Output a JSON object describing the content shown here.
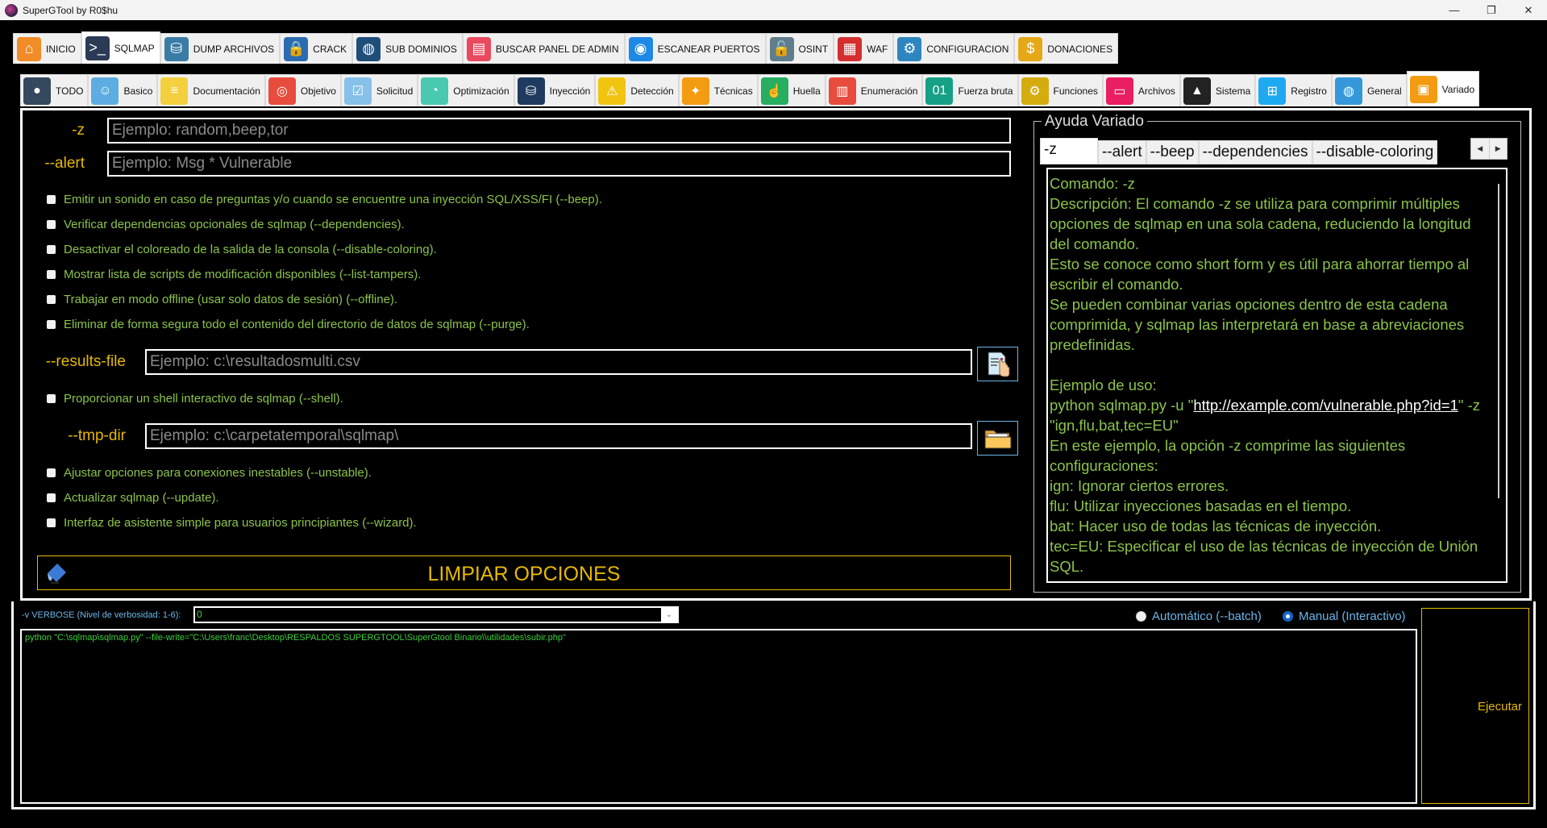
{
  "window": {
    "title": "SuperGTool by R0$hu",
    "controls": [
      "minimize",
      "maximize",
      "close"
    ]
  },
  "main_tabs": [
    {
      "label": "INICIO",
      "icon": "home-icon",
      "color": "#f28c28"
    },
    {
      "label": "SQLMAP",
      "icon": "terminal-icon",
      "color": "#2b3a55",
      "active": true
    },
    {
      "label": "DUMP ARCHIVOS",
      "icon": "database-download-icon",
      "color": "#3a7ca5"
    },
    {
      "label": "CRACK",
      "icon": "password-lock-icon",
      "color": "#2b6cb0"
    },
    {
      "label": "SUB DOMINIOS",
      "icon": "network-globe-icon",
      "color": "#1f4e79"
    },
    {
      "label": "BUSCAR PANEL DE ADMIN",
      "icon": "admin-panel-icon",
      "color": "#e84a5f"
    },
    {
      "label": "ESCANEAR PUERTOS",
      "icon": "port-scan-icon",
      "color": "#1e88e5"
    },
    {
      "label": "OSINT",
      "icon": "unlock-user-icon",
      "color": "#607d8b"
    },
    {
      "label": "WAF",
      "icon": "firewall-icon",
      "color": "#d32f2f"
    },
    {
      "label": "CONFIGURACION",
      "icon": "gear-icon",
      "color": "#2e86c1"
    },
    {
      "label": "DONACIONES",
      "icon": "donate-box-icon",
      "color": "#e6a817"
    }
  ],
  "sub_tabs": [
    {
      "label": "TODO",
      "icon": "hacker-icon",
      "color": "#34495e"
    },
    {
      "label": "Basico",
      "icon": "robot-icon",
      "color": "#5dade2"
    },
    {
      "label": "Documentación",
      "icon": "sql-document-icon",
      "color": "#f4d03f"
    },
    {
      "label": "Objetivo",
      "icon": "target-icon",
      "color": "#e74c3c"
    },
    {
      "label": "Solicitud",
      "icon": "checklist-icon",
      "color": "#85c1e9"
    },
    {
      "label": "Optimización",
      "icon": "speedometer-icon",
      "color": "#48c9b0"
    },
    {
      "label": "Inyección",
      "icon": "database-inject-icon",
      "color": "#1f3a5f"
    },
    {
      "label": "Detección",
      "icon": "warning-search-icon",
      "color": "#f1c40f"
    },
    {
      "label": "Técnicas",
      "icon": "lightbulb-gear-icon",
      "color": "#f39c12"
    },
    {
      "label": "Huella",
      "icon": "fingerprint-icon",
      "color": "#27ae60"
    },
    {
      "label": "Enumeración",
      "icon": "server-user-icon",
      "color": "#e74c3c"
    },
    {
      "label": "Fuerza bruta",
      "icon": "binary-chat-icon",
      "color": "#16a085"
    },
    {
      "label": "Funciones",
      "icon": "head-gear-icon",
      "color": "#d4ac0d"
    },
    {
      "label": "Archivos",
      "icon": "root-file-icon",
      "color": "#e91e63"
    },
    {
      "label": "Sistema",
      "icon": "linux-penguin-icon",
      "color": "#222222"
    },
    {
      "label": "Registro",
      "icon": "windows-icon",
      "color": "#1eaaf1"
    },
    {
      "label": "General",
      "icon": "globe-cycle-icon",
      "color": "#3498db"
    },
    {
      "label": "Variado",
      "icon": "toolbox-icon",
      "color": "#f39c12",
      "active": true
    }
  ],
  "form": {
    "z": {
      "label": "-z",
      "placeholder": "Ejemplo: random,beep,tor",
      "value": ""
    },
    "alert": {
      "label": "--alert",
      "placeholder": "Ejemplo: Msg * Vulnerable",
      "value": ""
    },
    "checks_a": [
      {
        "label": "Emitir un sonido en caso de preguntas y/o cuando se encuentre una inyección SQL/XSS/FI (--beep).",
        "checked": false
      },
      {
        "label": "Verificar dependencias opcionales de sqlmap (--dependencies).",
        "checked": false
      },
      {
        "label": "Desactivar el coloreado de la salida de la consola (--disable-coloring).",
        "checked": false
      },
      {
        "label": "Mostrar lista de scripts de modificación disponibles (--list-tampers).",
        "checked": false
      },
      {
        "label": "Trabajar en modo offline (usar solo datos de sesión) (--offline).",
        "checked": false
      },
      {
        "label": "Eliminar de forma segura todo el contenido del directorio de datos de sqlmap (--purge).",
        "checked": false
      }
    ],
    "results_file": {
      "label": "--results-file",
      "placeholder": "Ejemplo: c:\\resultadosmulti.csv",
      "value": "",
      "button_icon": "file-select-icon"
    },
    "check_shell": {
      "label": "Proporcionar un shell interactivo de sqlmap (--shell).",
      "checked": false
    },
    "tmp_dir": {
      "label": "--tmp-dir",
      "placeholder": "Ejemplo: c:\\carpetatemporal\\sqlmap\\",
      "value": "",
      "button_icon": "folder-icon"
    },
    "checks_b": [
      {
        "label": "Ajustar opciones para conexiones inestables (--unstable).",
        "checked": false
      },
      {
        "label": "Actualizar sqlmap (--update).",
        "checked": false
      },
      {
        "label": "Interfaz de asistente simple para usuarios principiantes (--wizard).",
        "checked": false
      }
    ],
    "clear_button": "LIMPIAR OPCIONES"
  },
  "help": {
    "title": "Ayuda Variado",
    "tabs": [
      "-z",
      "--alert",
      "--beep",
      "--dependencies",
      "--disable-coloring"
    ],
    "active_tab": 0,
    "text_before_link": "Comando: -z\nDescripción: El comando -z se utiliza para comprimir múltiples opciones de sqlmap en una sola cadena, reduciendo la longitud del comando.\nEsto se conoce como short form y es útil para ahorrar tiempo al escribir el comando.\nSe pueden combinar varias opciones dentro de esta cadena comprimida, y sqlmap las interpretará en base a abreviaciones predefinidas.\n\nEjemplo de uso:\npython sqlmap.py -u \"",
    "link": "http://example.com/vulnerable.php?id=1",
    "text_after_link": "\" -z \"ign,flu,bat,tec=EU\"\nEn este ejemplo, la opción -z comprime las siguientes configuraciones:\nign: Ignorar ciertos errores.\nflu: Utilizar inyecciones basadas en el tiempo.\nbat: Hacer uso de todas las técnicas de inyección.\ntec=EU: Especificar el uso de las técnicas de inyección de Unión SQL."
  },
  "bottom": {
    "verbose_label": "-v VERBOSE (Nivel de verbosidad: 1-6):",
    "verbose_value": "0",
    "radio_auto": {
      "label": "Automático (--batch)",
      "selected": false
    },
    "radio_manual": {
      "label": "Manual (Interactivo)",
      "selected": true
    },
    "console_text": "python \"C:\\sqlmap\\sqlmap.py\" --file-write=\"C:\\Users\\franc\\Desktop\\RESPALDOS SUPERGTOOL\\SuperGtool Binario\\\\utilidades\\subir.php\"",
    "execute_button": "Ejecutar"
  },
  "colors": {
    "accent_label": "#e6b800",
    "option_text": "#8bc34a",
    "console_text": "#3ecf3e",
    "info_text": "#6bb6e8",
    "background": "#000000"
  }
}
